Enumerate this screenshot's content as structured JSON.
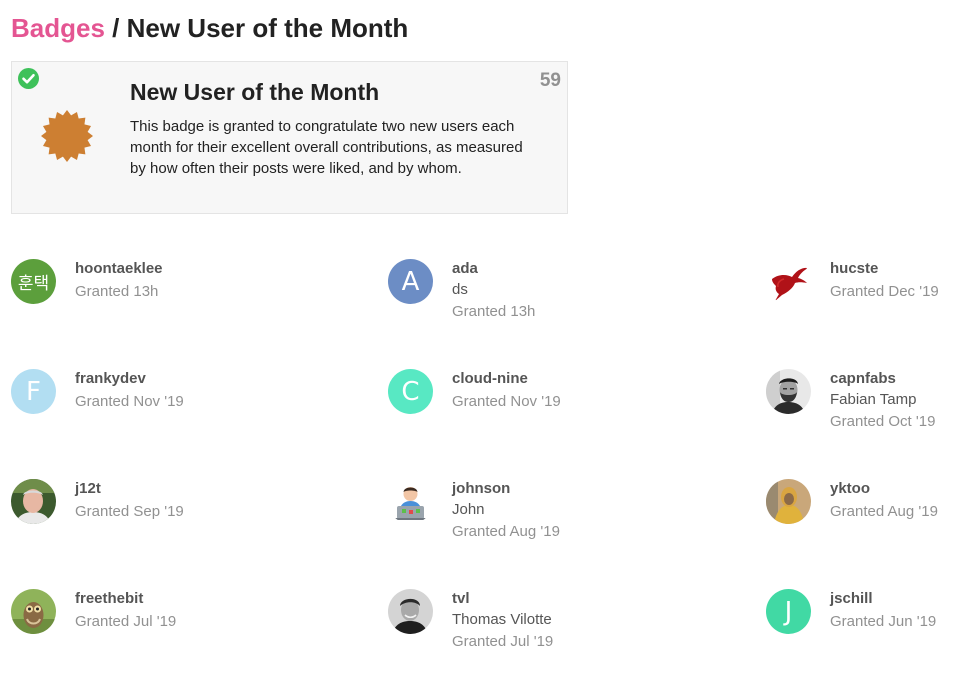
{
  "breadcrumb": {
    "parent_label": "Badges",
    "separator": "/",
    "current": "New User of the Month"
  },
  "badge": {
    "name": "New User of the Month",
    "description": "This badge is granted to congratulate two new users each month for their excellent overall contributions, as measured by how often their posts were liked, and by whom.",
    "count": "59",
    "icon": "badge-sunburst-icon",
    "icon_color": "#cd7f32",
    "granted_icon": "check-circle-icon",
    "granted_color": "#3ec15a"
  },
  "users": [
    {
      "username": "hoontaeklee",
      "name": "",
      "granted": "Granted 13h",
      "avatar": {
        "type": "letter",
        "letter": "훈택",
        "color": "#5c9f3c"
      }
    },
    {
      "username": "ada",
      "name": "ds",
      "granted": "Granted 13h",
      "avatar": {
        "type": "letter",
        "letter": "A",
        "color": "#6c8dc5"
      }
    },
    {
      "username": "hucste",
      "name": "",
      "granted": "Granted Dec '19",
      "avatar": {
        "type": "image",
        "icon": "red-bird-icon"
      }
    },
    {
      "username": "frankydev",
      "name": "",
      "granted": "Granted Nov '19",
      "avatar": {
        "type": "letter",
        "letter": "F",
        "color": "#b2def2"
      }
    },
    {
      "username": "cloud-nine",
      "name": "",
      "granted": "Granted Nov '19",
      "avatar": {
        "type": "letter",
        "letter": "C",
        "color": "#58e8c3"
      }
    },
    {
      "username": "capnfabs",
      "name": "Fabian Tamp",
      "granted": "Granted Oct '19",
      "avatar": {
        "type": "image",
        "icon": "bearded-man-photo-icon"
      }
    },
    {
      "username": "j12t",
      "name": "",
      "granted": "Granted Sep '19",
      "avatar": {
        "type": "image",
        "icon": "man-outdoors-photo-icon"
      }
    },
    {
      "username": "johnson",
      "name": "John",
      "granted": "Granted Aug '19",
      "avatar": {
        "type": "image",
        "icon": "person-at-laptop-icon"
      }
    },
    {
      "username": "yktoo",
      "name": "",
      "granted": "Granted Aug '19",
      "avatar": {
        "type": "image",
        "icon": "yellow-jacket-photo-icon"
      }
    },
    {
      "username": "freethebit",
      "name": "",
      "granted": "Granted Jul '19",
      "avatar": {
        "type": "image",
        "icon": "owl-photo-icon"
      }
    },
    {
      "username": "tvl",
      "name": "Thomas Vilotte",
      "granted": "Granted Jul '19",
      "avatar": {
        "type": "image",
        "icon": "man-grayscale-photo-icon"
      }
    },
    {
      "username": "jschill",
      "name": "",
      "granted": "Granted Jun '19",
      "avatar": {
        "type": "letter",
        "letter": "J",
        "color": "#41d9a4"
      }
    }
  ]
}
